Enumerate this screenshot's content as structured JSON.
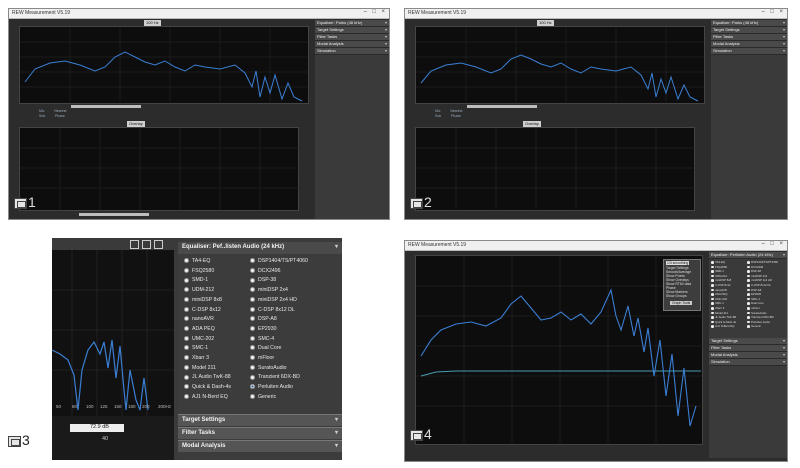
{
  "app": {
    "window_title": "REW Measurement V5.19",
    "zoom_button_label": "100 Hz",
    "khz_label": "1kHz",
    "legend_rows": [
      {
        "name": "Mic",
        "value": "Nearest"
      },
      {
        "name": "Sub",
        "value": "Phase"
      }
    ]
  },
  "side_sections_small": [
    "Equaliser: Parks (48 kHz)",
    "Target Settings",
    "Filter Tasks",
    "Modal Analysis",
    "Simulation"
  ],
  "panel3": {
    "header": "Equaliser: Pef..listen Audio (24 kHz)",
    "left_column": [
      "TA4-EQ",
      "FSQ2580",
      "SMD-1",
      "UDM-212",
      "miniDSP 8x8",
      "C-DSP 8x12",
      "nanoAVR",
      "ADA PEQ",
      "UMC-202",
      "SMC-1",
      "Xbarr 3",
      "Model 211",
      "JL Audio TwK-88",
      "Quick & Dash-4s",
      "AJ1 N-Berd EQ"
    ],
    "right_column": [
      "DSP1404/TS/PT4060",
      "DCX2496",
      "DSP-38",
      "miniDSP 2x4",
      "miniDSP 2x4 HD",
      "C-DSP 8x12 DL",
      "DSP-A8",
      "EP2930",
      "SMC-4",
      "Dual Core",
      "mFloor",
      "SuratoAudio",
      "Tranzient 6DX-BD",
      "Perluiten Audio",
      "Generic"
    ],
    "selected": "Perluiten Audio",
    "readout_db": "72.9 dB",
    "readout_db2": "40",
    "axis_ticks": [
      "50",
      "80",
      "100",
      "125",
      "150",
      "180",
      "200",
      "200Hz"
    ],
    "sections": [
      "Target Settings",
      "Filter Tasks",
      "Modal Analysis"
    ]
  },
  "panel4": {
    "header": "Equaliser: Perlisten Audio (24 kHz)",
    "dropdown_items": [
      "1/3 smoothing",
      "Target Settings",
      "Smooth/Average",
      "Show Points",
      "Show Overlays",
      "Show RT60 data",
      "Phase",
      "Show Markers",
      "Show Groups"
    ],
    "dropdown_title": "Graph Tools",
    "sections": [
      "Target Settings",
      "Filter Tasks",
      "Modal Analysis",
      "Simulation"
    ]
  },
  "labels": {
    "one": "1",
    "two": "2",
    "three": "3",
    "four": "4"
  },
  "colors": {
    "trace": "#3b7fd4",
    "target": "#4a9ab0",
    "bg": "#2c2c2c",
    "plot": "#0d0d0d"
  }
}
